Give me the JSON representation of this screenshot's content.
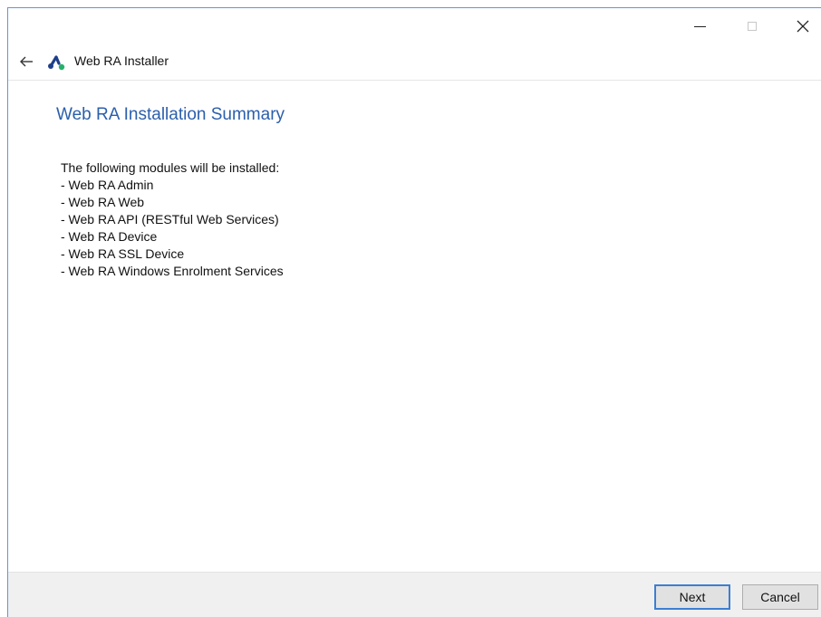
{
  "window": {
    "title": "Web RA Installer",
    "controls": {
      "minimize_icon": "minimize-icon",
      "maximize_icon": "maximize-icon",
      "close_icon": "close-icon"
    }
  },
  "header": {
    "back_icon": "back-arrow-icon",
    "app_icon": "web-ra-logo-icon",
    "app_title": "Web RA Installer"
  },
  "main": {
    "title": "Web RA Installation Summary",
    "intro": "The following modules will be installed:",
    "modules": [
      "- Web RA Admin",
      "- Web RA Web",
      "- Web RA API (RESTful Web Services)",
      "- Web RA Device",
      "- Web RA SSL Device",
      "- Web RA Windows Enrolment Services"
    ]
  },
  "footer": {
    "next_label": "Next",
    "cancel_label": "Cancel"
  },
  "colors": {
    "title_blue": "#2b5fad",
    "focus_blue": "#3c7fd4",
    "logo_dark": "#1e3f8a",
    "logo_green": "#27b06a"
  }
}
